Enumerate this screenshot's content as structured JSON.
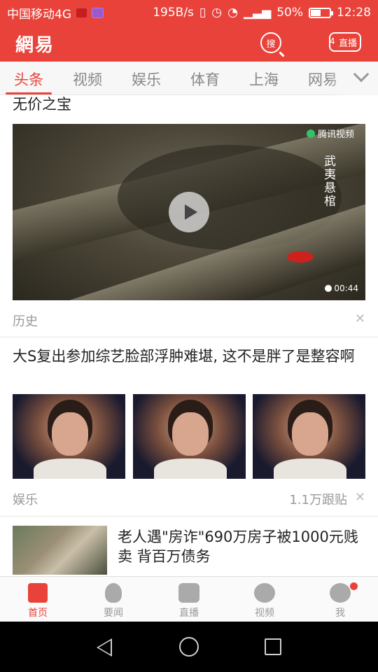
{
  "status_bar": {
    "carrier": "中国移动4G",
    "net_speed": "195B/s",
    "battery": "50%",
    "battery_fraction": 0.5,
    "time": "12:28"
  },
  "header": {
    "logo": "網易",
    "search_label": "搜",
    "live_count": "4",
    "live_label": "直播"
  },
  "tabs": [
    "头条",
    "视频",
    "娱乐",
    "体育",
    "上海",
    "网易"
  ],
  "feed": {
    "video_item": {
      "title": "无价之宝",
      "watermark": "腾讯视频",
      "vertical_text": "武夷悬棺",
      "duration": "00:44",
      "category": "历史"
    },
    "article2": {
      "title": "大S复出参加综艺脸部浮肿难堪, 这不是胖了是整容啊",
      "category": "娱乐",
      "comments": "1.1万跟贴"
    },
    "article3": {
      "title": "老人遇\"房诈\"690万房子被1000元贱卖 背百万债务"
    }
  },
  "tabbar": {
    "items": [
      {
        "label": "首页",
        "icon": "news-doc-icon"
      },
      {
        "label": "要闻",
        "icon": "bulb-icon"
      },
      {
        "label": "直播",
        "icon": "camera-icon"
      },
      {
        "label": "视频",
        "icon": "play-icon"
      },
      {
        "label": "我",
        "icon": "person-icon"
      }
    ]
  },
  "colors": {
    "brand_red": "#e8423a",
    "muted_text": "#999999"
  }
}
